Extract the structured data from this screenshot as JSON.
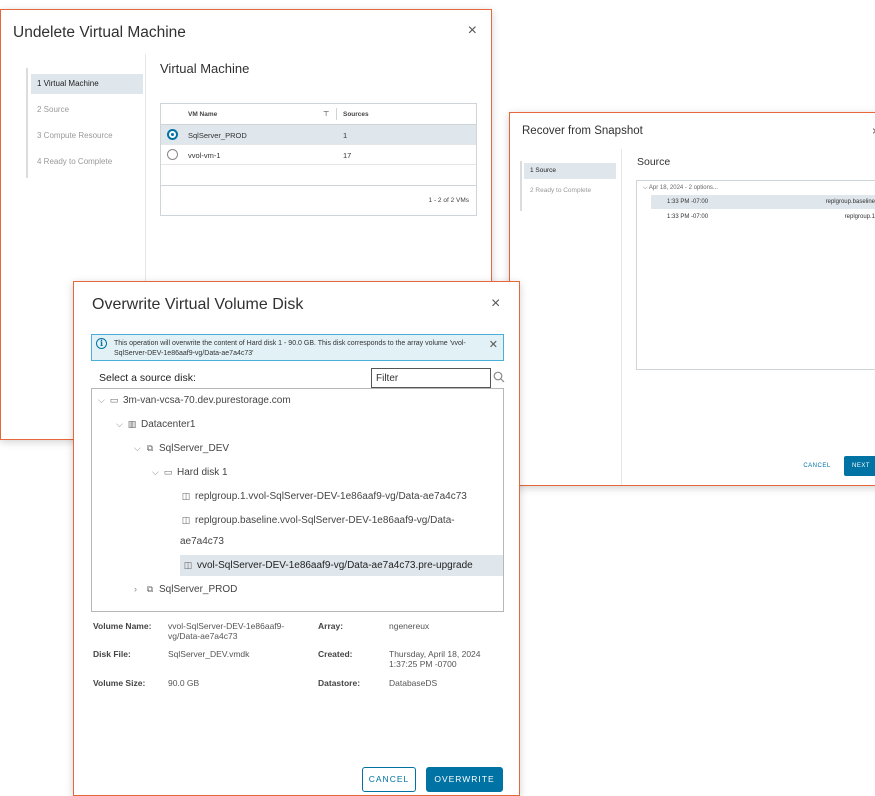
{
  "undelete_dialog": {
    "title": "Undelete Virtual Machine",
    "close_glyph": "×",
    "steps": [
      {
        "label": "1 Virtual Machine",
        "active": true
      },
      {
        "label": "2 Source",
        "active": false
      },
      {
        "label": "3 Compute Resource",
        "active": false
      },
      {
        "label": "4 Ready to Complete",
        "active": false
      }
    ],
    "heading": "Virtual Machine",
    "grid": {
      "columns": [
        "VM Name",
        "Sources"
      ],
      "filter_icon": "filter-icon",
      "rows": [
        {
          "name": "SqlServer_PROD",
          "sources": "1",
          "selected": true
        },
        {
          "name": "vvol-vm-1",
          "sources": "17",
          "selected": false
        }
      ],
      "footer": "1 - 2 of 2 VMs"
    }
  },
  "recover_dialog": {
    "title": "Recover from Snapshot",
    "close_glyph": "×",
    "steps": [
      {
        "label": "1 Source",
        "active": true
      },
      {
        "label": "2 Ready to Complete",
        "active": false
      }
    ],
    "heading": "Source",
    "group_label": "Apr 18, 2024 - 2 options...",
    "snapshots": [
      {
        "time": "1:33 PM -07:00",
        "group": "replgroup.baseline",
        "selected": true
      },
      {
        "time": "1:33 PM -07:00",
        "group": "replgroup.1",
        "selected": false
      }
    ],
    "cancel_label": "CANCEL",
    "next_label": "NEXT"
  },
  "overwrite_dialog": {
    "title": "Overwrite Virtual Volume Disk",
    "close_glyph": "×",
    "info_message": "This operation will overwrite the content of Hard disk 1 - 90.0 GB. This disk corresponds to the array volume 'vvol-SqlServer-DEV-1e86aaf9-vg/Data-ae7a4c73'",
    "select_label": "Select a source disk:",
    "filter_placeholder": "Filter",
    "tree": {
      "vcenter": "3m-van-vcsa-70.dev.purestorage.com",
      "datacenter": "Datacenter1",
      "vm_dev": "SqlServer_DEV",
      "disk": "Hard disk 1",
      "snap1": "replgroup.1.vvol-SqlServer-DEV-1e86aaf9-vg/Data-ae7a4c73",
      "snap2_line1": "replgroup.baseline.vvol-SqlServer-DEV-1e86aaf9-vg/Data-",
      "snap2_line2": "ae7a4c73",
      "snap3": "vvol-SqlServer-DEV-1e86aaf9-vg/Data-ae7a4c73.pre-upgrade",
      "vm_prod": "SqlServer_PROD"
    },
    "details": {
      "volume_name_label": "Volume Name:",
      "volume_name_line1": "vvol-SqlServer-DEV-1e86aaf9-",
      "volume_name_line2": "vg/Data-ae7a4c73",
      "array_label": "Array:",
      "array_value": "ngenereux",
      "disk_file_label": "Disk File:",
      "disk_file_value": "SqlServer_DEV.vmdk",
      "created_label": "Created:",
      "created_line1": "Thursday, April 18, 2024",
      "created_line2": "1:37:25 PM -0700",
      "volume_size_label": "Volume Size:",
      "volume_size_value": "90.0 GB",
      "datastore_label": "Datastore:",
      "datastore_value": "DatabaseDS"
    },
    "cancel_label": "CANCEL",
    "confirm_label": "OVERWRITE"
  },
  "colors": {
    "accent_border": "#e5673a",
    "primary": "#0072a3",
    "selection": "#dfe6ec",
    "info_bg": "#e1f1f6"
  }
}
